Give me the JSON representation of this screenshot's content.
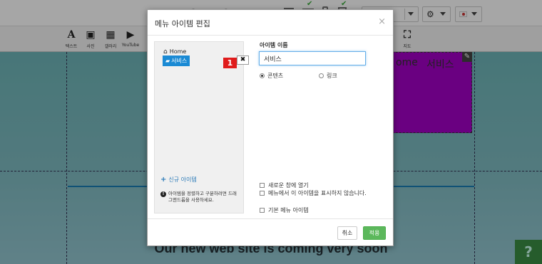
{
  "secondbar": {
    "items": [
      {
        "glyph": "A",
        "label": "텍스트"
      },
      {
        "glyph": "▣",
        "label": "사진"
      },
      {
        "glyph": "▦",
        "label": "갤러리"
      },
      {
        "glyph": "▶",
        "label": "YouTube"
      },
      {
        "glyph": "⛶",
        "label": "지도"
      }
    ]
  },
  "canvas": {
    "nav_items": [
      "ome",
      "서비스"
    ],
    "footer_text": "Our new web site is coming very soon",
    "help_label": "?"
  },
  "modal": {
    "title": "메뉴 아이템 편집",
    "close": "×",
    "tree": {
      "home_label": "Home",
      "service_label": "서비스"
    },
    "annotation_number": "1",
    "delete_label": "✖",
    "new_item_label": "신규 아이템",
    "hint_text": "아이템을 정렬하고 구분하려면 드래그앤드롭을 사용하세요.",
    "item_name_label": "아이템 이름",
    "item_name_value": "서비스",
    "radio_content": "콘텐츠",
    "radio_link": "링크",
    "check_new_window": "새로운 창에 열기",
    "check_hide": "메뉴에서 이 아이템을 표시하지 않습니다.",
    "check_default": "기본 메뉴 아이템",
    "cancel_label": "취소",
    "apply_label": "적용"
  },
  "colors": {
    "accent": "#1a8ad4",
    "apply": "#5cb85c",
    "magenta": "#a400c6",
    "badge": "#e01c1c"
  }
}
